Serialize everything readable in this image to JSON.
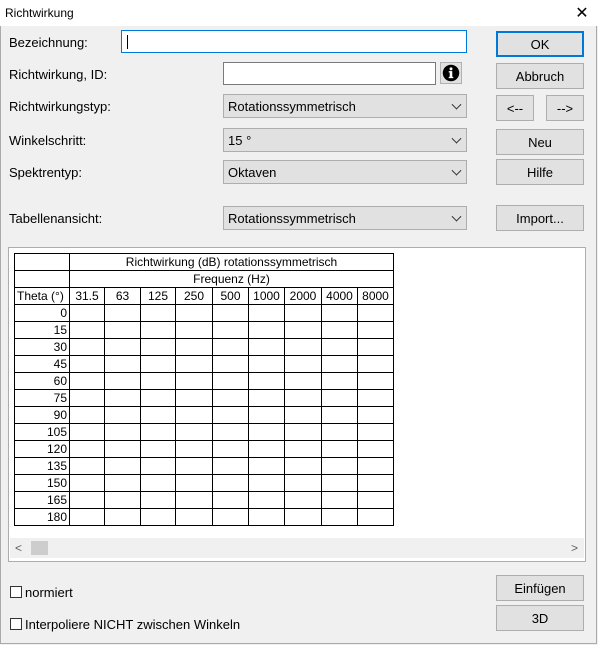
{
  "window": {
    "title": "Richtwirkung",
    "close_glyph": "✕"
  },
  "form": {
    "bezeichnung_label": "Bezeichnung:",
    "bezeichnung_value": "",
    "id_label": "Richtwirkung, ID:",
    "id_value": "",
    "typ_label": "Richtwirkungstyp:",
    "typ_value": "Rotationssymmetrisch",
    "winkel_label": "Winkelschritt:",
    "winkel_value": "15 °",
    "spektren_label": "Spektrentyp:",
    "spektren_value": "Oktaven",
    "tabelle_label": "Tabellenansicht:",
    "tabelle_value": "Rotationssymmetrisch"
  },
  "buttons": {
    "ok": "OK",
    "abbruch": "Abbruch",
    "prev": "<--",
    "next": "-->",
    "neu": "Neu",
    "hilfe": "Hilfe",
    "import": "Import...",
    "einfuegen": "Einfügen",
    "d3": "3D"
  },
  "table": {
    "title": "Richtwirkung (dB) rotationssymmetrisch",
    "freq_header": "Frequenz (Hz)",
    "theta_header": "Theta (°)",
    "frequencies": [
      "31.5",
      "63",
      "125",
      "250",
      "500",
      "1000",
      "2000",
      "4000",
      "8000"
    ],
    "angles": [
      "0",
      "15",
      "30",
      "45",
      "60",
      "75",
      "90",
      "105",
      "120",
      "135",
      "150",
      "165",
      "180"
    ]
  },
  "scrollbar": {
    "left_arrow": "<",
    "right_arrow": ">"
  },
  "options": {
    "normiert": "normiert",
    "interpoliere": "Interpoliere NICHT zwischen Winkeln"
  },
  "icons": {
    "info": "info-icon",
    "close": "close-icon",
    "chevron": "chevron-down-icon"
  }
}
